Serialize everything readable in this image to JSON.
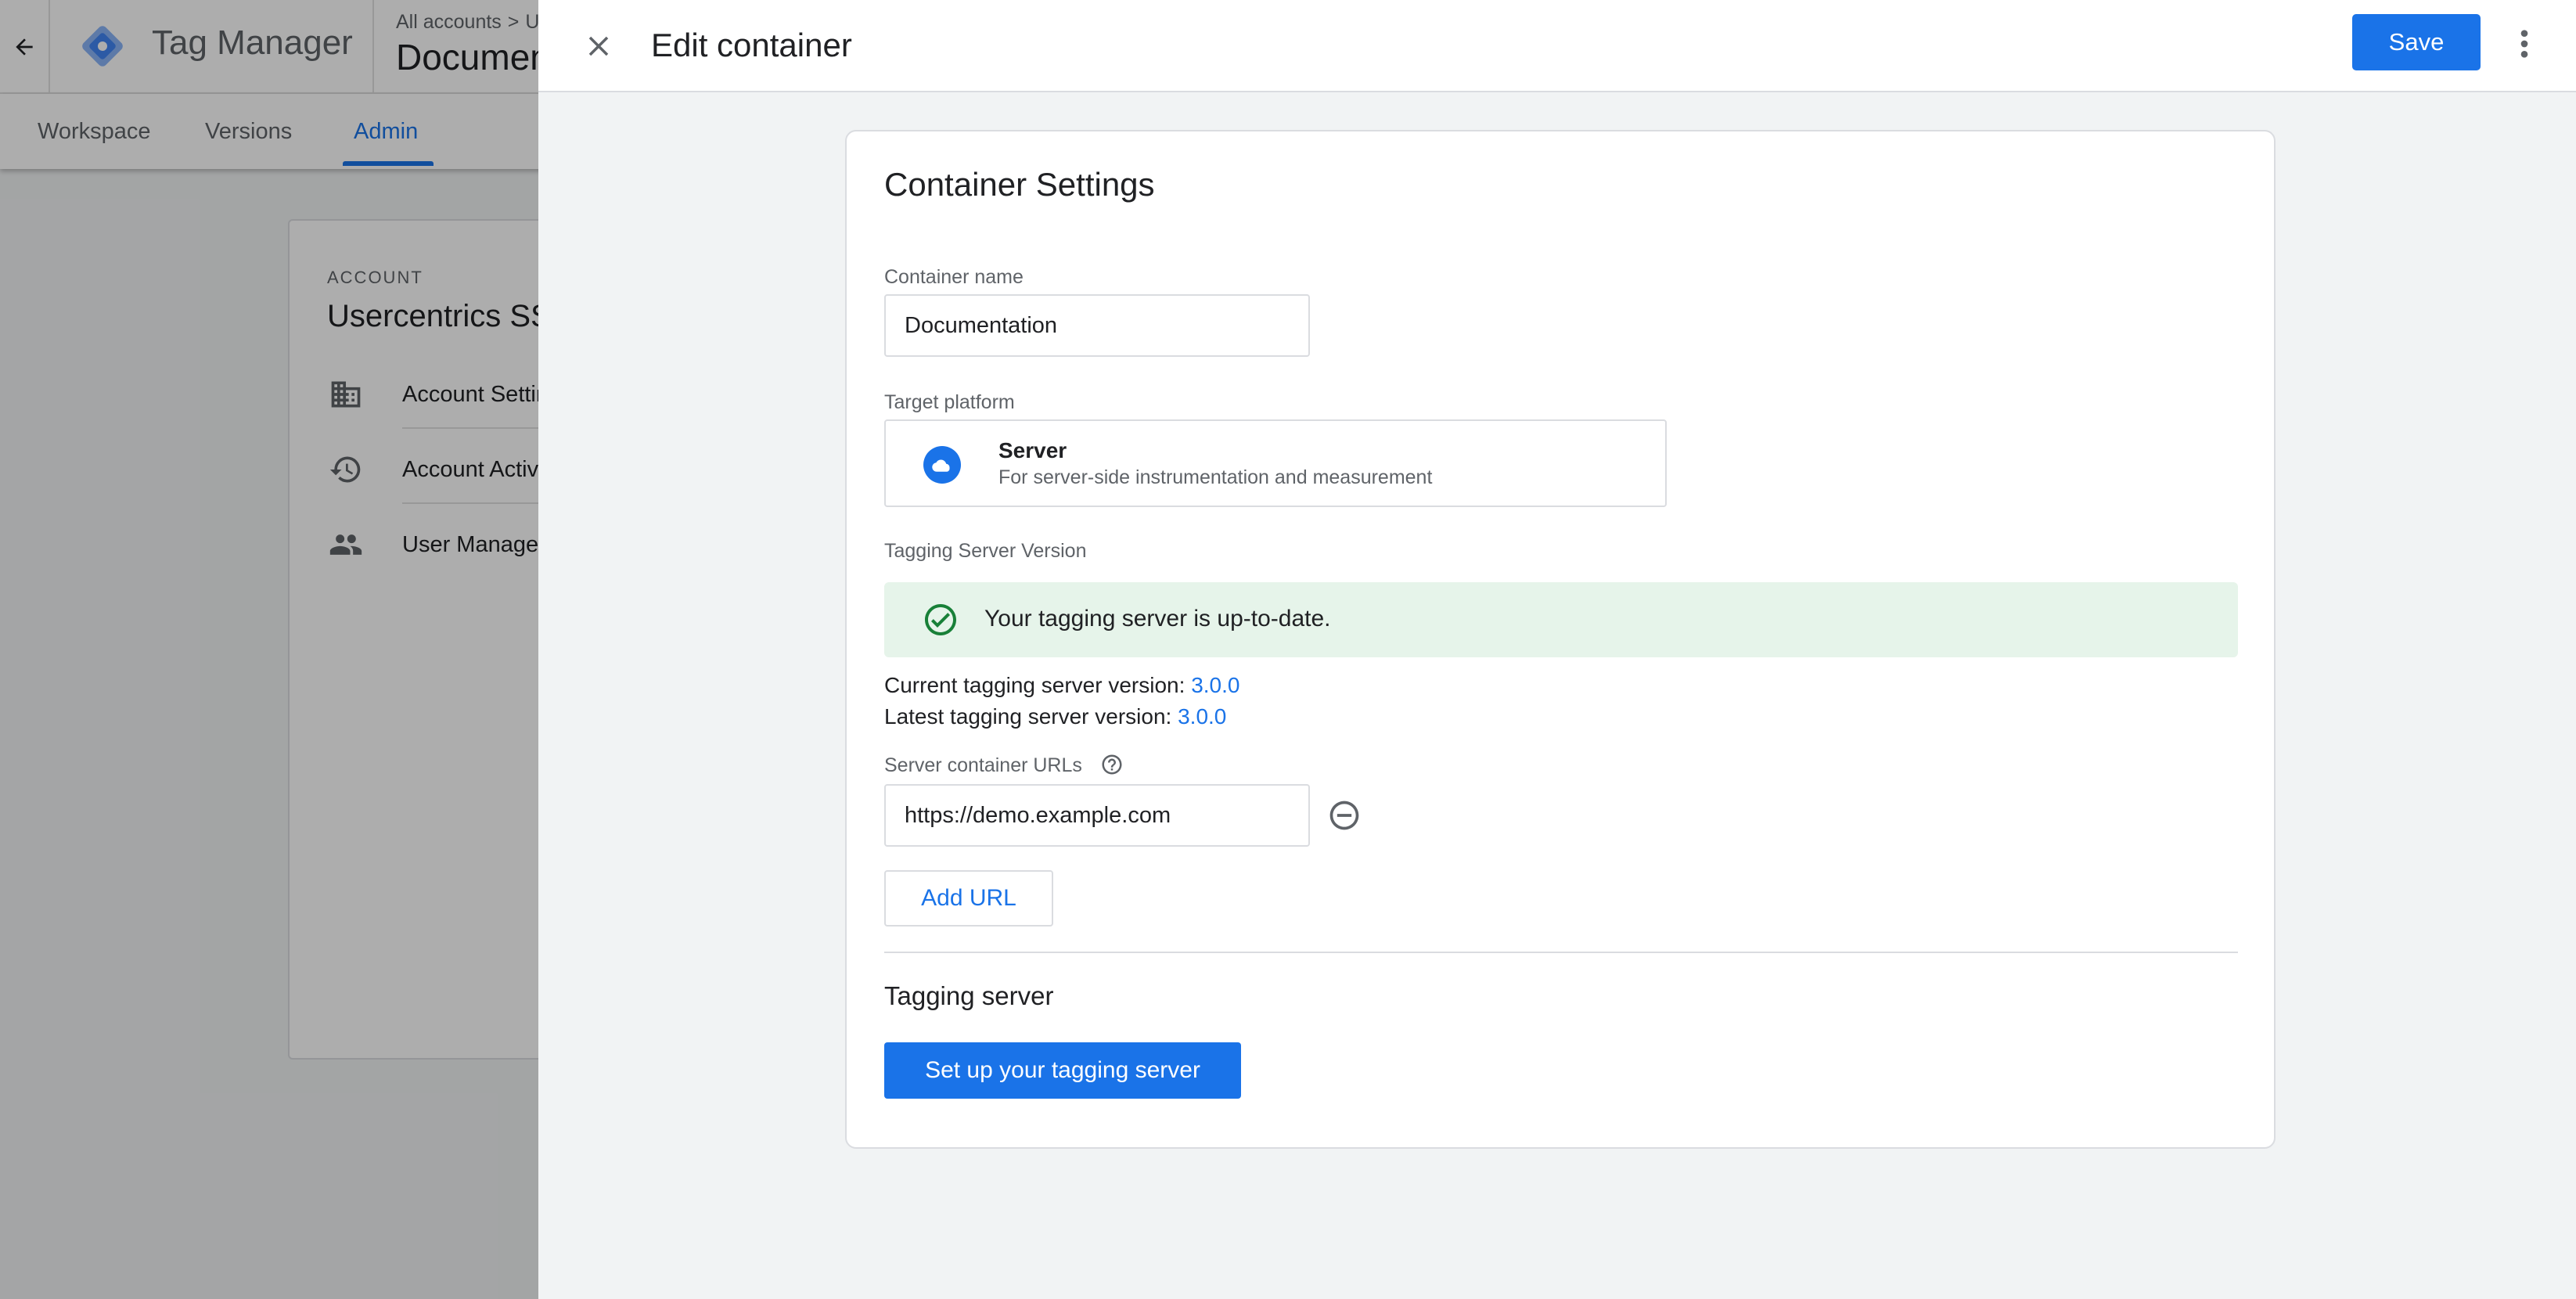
{
  "app": {
    "name": "Tag Manager",
    "breadcrumb_root": "All accounts",
    "breadcrumb_sep": ">",
    "breadcrumb_next": "U",
    "container_title": "Documentation"
  },
  "tabs": [
    {
      "label": "Workspace"
    },
    {
      "label": "Versions"
    },
    {
      "label": "Admin",
      "active": true
    }
  ],
  "account": {
    "kicker": "ACCOUNT",
    "name": "Usercentrics SSGTM",
    "items": [
      {
        "label": "Account Settings",
        "icon": "building-icon"
      },
      {
        "label": "Account Activity",
        "icon": "history-icon"
      },
      {
        "label": "User Management",
        "icon": "people-icon"
      }
    ]
  },
  "panel": {
    "title": "Edit container",
    "save_label": "Save",
    "close_icon": "close-icon",
    "more_icon": "more-vert-icon"
  },
  "settings": {
    "title": "Container Settings",
    "container_name_label": "Container name",
    "container_name_value": "Documentation",
    "target_platform_label": "Target platform",
    "platform": {
      "name": "Server",
      "description": "For server-side instrumentation and measurement",
      "icon": "cloud-icon"
    },
    "tagging_server_version_label": "Tagging Server Version",
    "status_message": "Your tagging server is up-to-date.",
    "current_version_label": "Current tagging server version:",
    "current_version": "3.0.0",
    "latest_version_label": "Latest tagging server version:",
    "latest_version": "3.0.0",
    "server_urls_label": "Server container URLs",
    "server_urls": [
      "https://demo.example.com"
    ],
    "add_url_label": "Add URL",
    "tagging_server_section": "Tagging server",
    "setup_button_label": "Set up your tagging server"
  },
  "colors": {
    "accent": "#1a73e8",
    "success_bg": "#e6f4ea",
    "success_icon": "#188038",
    "logo_primary": "#4285f4",
    "logo_secondary": "#8ab4f8"
  }
}
